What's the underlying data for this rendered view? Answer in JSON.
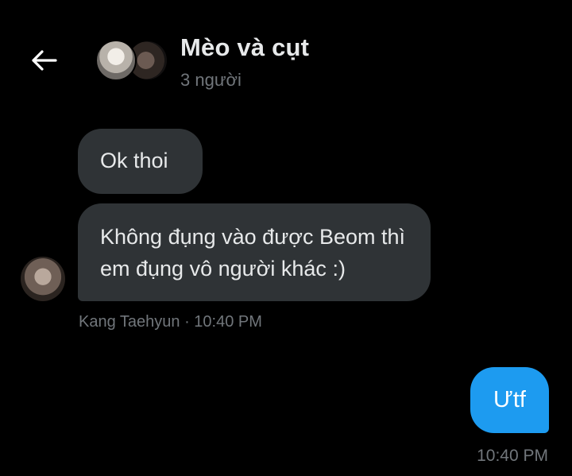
{
  "header": {
    "back_icon": "arrow-left-icon",
    "title": "Mèo và cụt",
    "subtitle": "3 người"
  },
  "messages": [
    {
      "text": "Ok thoi",
      "direction": "incoming"
    },
    {
      "text": "Không đụng vào được Beom thì em đụng vô người khác :)",
      "direction": "incoming"
    },
    {
      "text": "Ưtf",
      "direction": "outgoing"
    }
  ],
  "incoming_meta": "Kang Taehyun · 10:40 PM",
  "outgoing_meta": "10:40 PM",
  "colors": {
    "background": "#000000",
    "incoming_bubble": "#2f3336",
    "outgoing_bubble": "#1d9bf0",
    "secondary_text": "#71767b"
  }
}
